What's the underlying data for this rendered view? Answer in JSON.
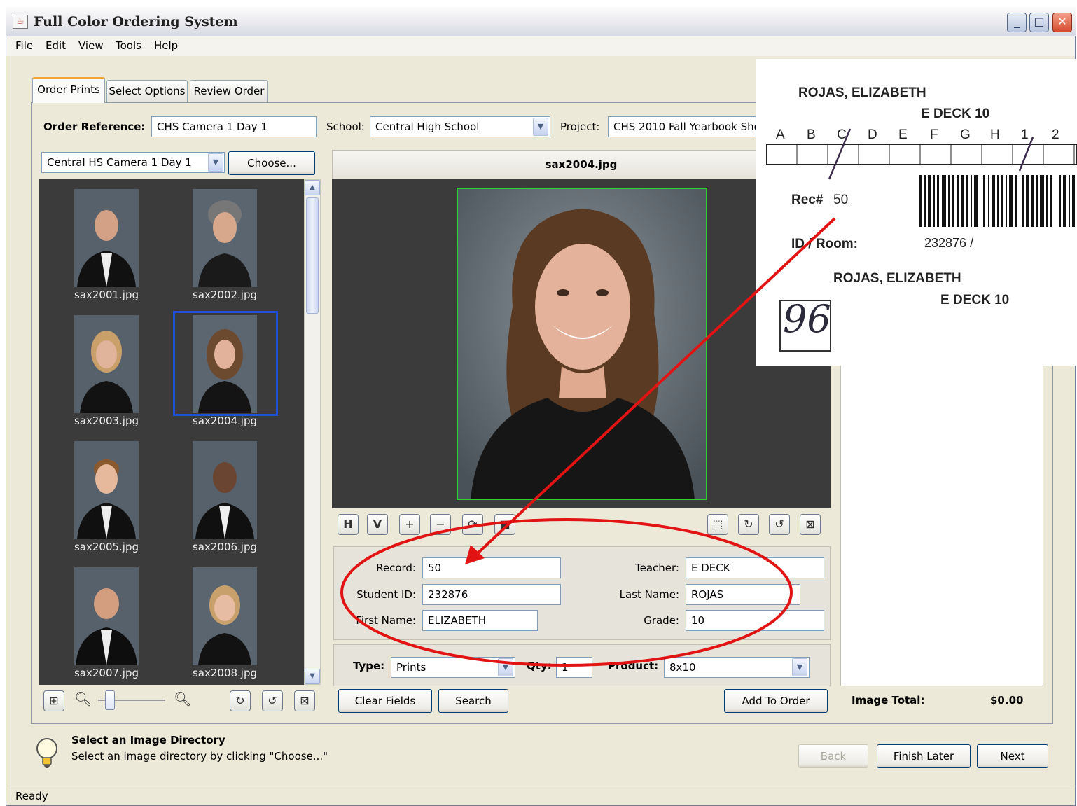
{
  "window": {
    "title": "Full Color Ordering System",
    "min": "_",
    "max": "□",
    "close": "✕"
  },
  "menu": [
    "File",
    "Edit",
    "View",
    "Tools",
    "Help"
  ],
  "tabs": [
    "Order Prints",
    "Select Options",
    "Review Order"
  ],
  "order": {
    "reference_label": "Order Reference:",
    "reference_value": "CHS Camera 1 Day 1",
    "school_label": "School:",
    "school_value": "Central High School",
    "project_label": "Project:",
    "project_value": "CHS 2010 Fall Yearbook Sho"
  },
  "directory": {
    "value": "Central HS Camera 1 Day 1",
    "choose_label": "Choose..."
  },
  "thumbnails": [
    "sax2001.jpg",
    "sax2002.jpg",
    "sax2003.jpg",
    "sax2004.jpg",
    "sax2005.jpg",
    "sax2006.jpg",
    "sax2007.jpg",
    "sax2008.jpg"
  ],
  "viewer": {
    "filename": "sax2004.jpg"
  },
  "toolbar_left": [
    "H",
    "V",
    "+",
    "−",
    "⟳",
    "■"
  ],
  "toolbar_right": [
    "⬚",
    "↻",
    "↺",
    "⊠"
  ],
  "record": {
    "record_label": "Record:",
    "record_value": "50",
    "student_id_label": "Student ID:",
    "student_id_value": "232876",
    "first_name_label": "First Name:",
    "first_name_value": "ELIZABETH",
    "teacher_label": "Teacher:",
    "teacher_value": "E DECK",
    "last_name_label": "Last Name:",
    "last_name_value": "ROJAS",
    "grade_label": "Grade:",
    "grade_value": "10"
  },
  "product": {
    "type_label": "Type:",
    "type_value": "Prints",
    "qty_label": "Qty:",
    "qty_value": "1",
    "product_label": "Product:",
    "product_value": "8x10"
  },
  "buttons": {
    "clear": "Clear Fields",
    "search": "Search",
    "add": "Add To Order",
    "back": "Back",
    "finish_later": "Finish Later",
    "next": "Next"
  },
  "image_total": {
    "label": "Image Total:",
    "value": "$0.00"
  },
  "hint": {
    "title": "Select an Image Directory",
    "text": "Select an image directory by clicking \"Choose...\""
  },
  "status": "Ready",
  "card": {
    "name_top": "ROJAS, ELIZABETH",
    "teacher_grade_top": "E DECK 10",
    "letters": [
      "A",
      "B",
      "C",
      "D",
      "E",
      "F",
      "G",
      "H",
      "1",
      "2"
    ],
    "rec_label": "Rec#",
    "rec_value": "50",
    "id_room_label": "ID / Room:",
    "id_value": "232876 /",
    "name_bottom": "ROJAS, ELIZABETH",
    "teacher_grade_bottom": "E DECK 10",
    "handwritten": "96"
  },
  "colors": {
    "annotation": "#e21313",
    "selection": "#1f4fd6",
    "crop": "#2fd12f",
    "tab_accent": "#f0a535"
  }
}
